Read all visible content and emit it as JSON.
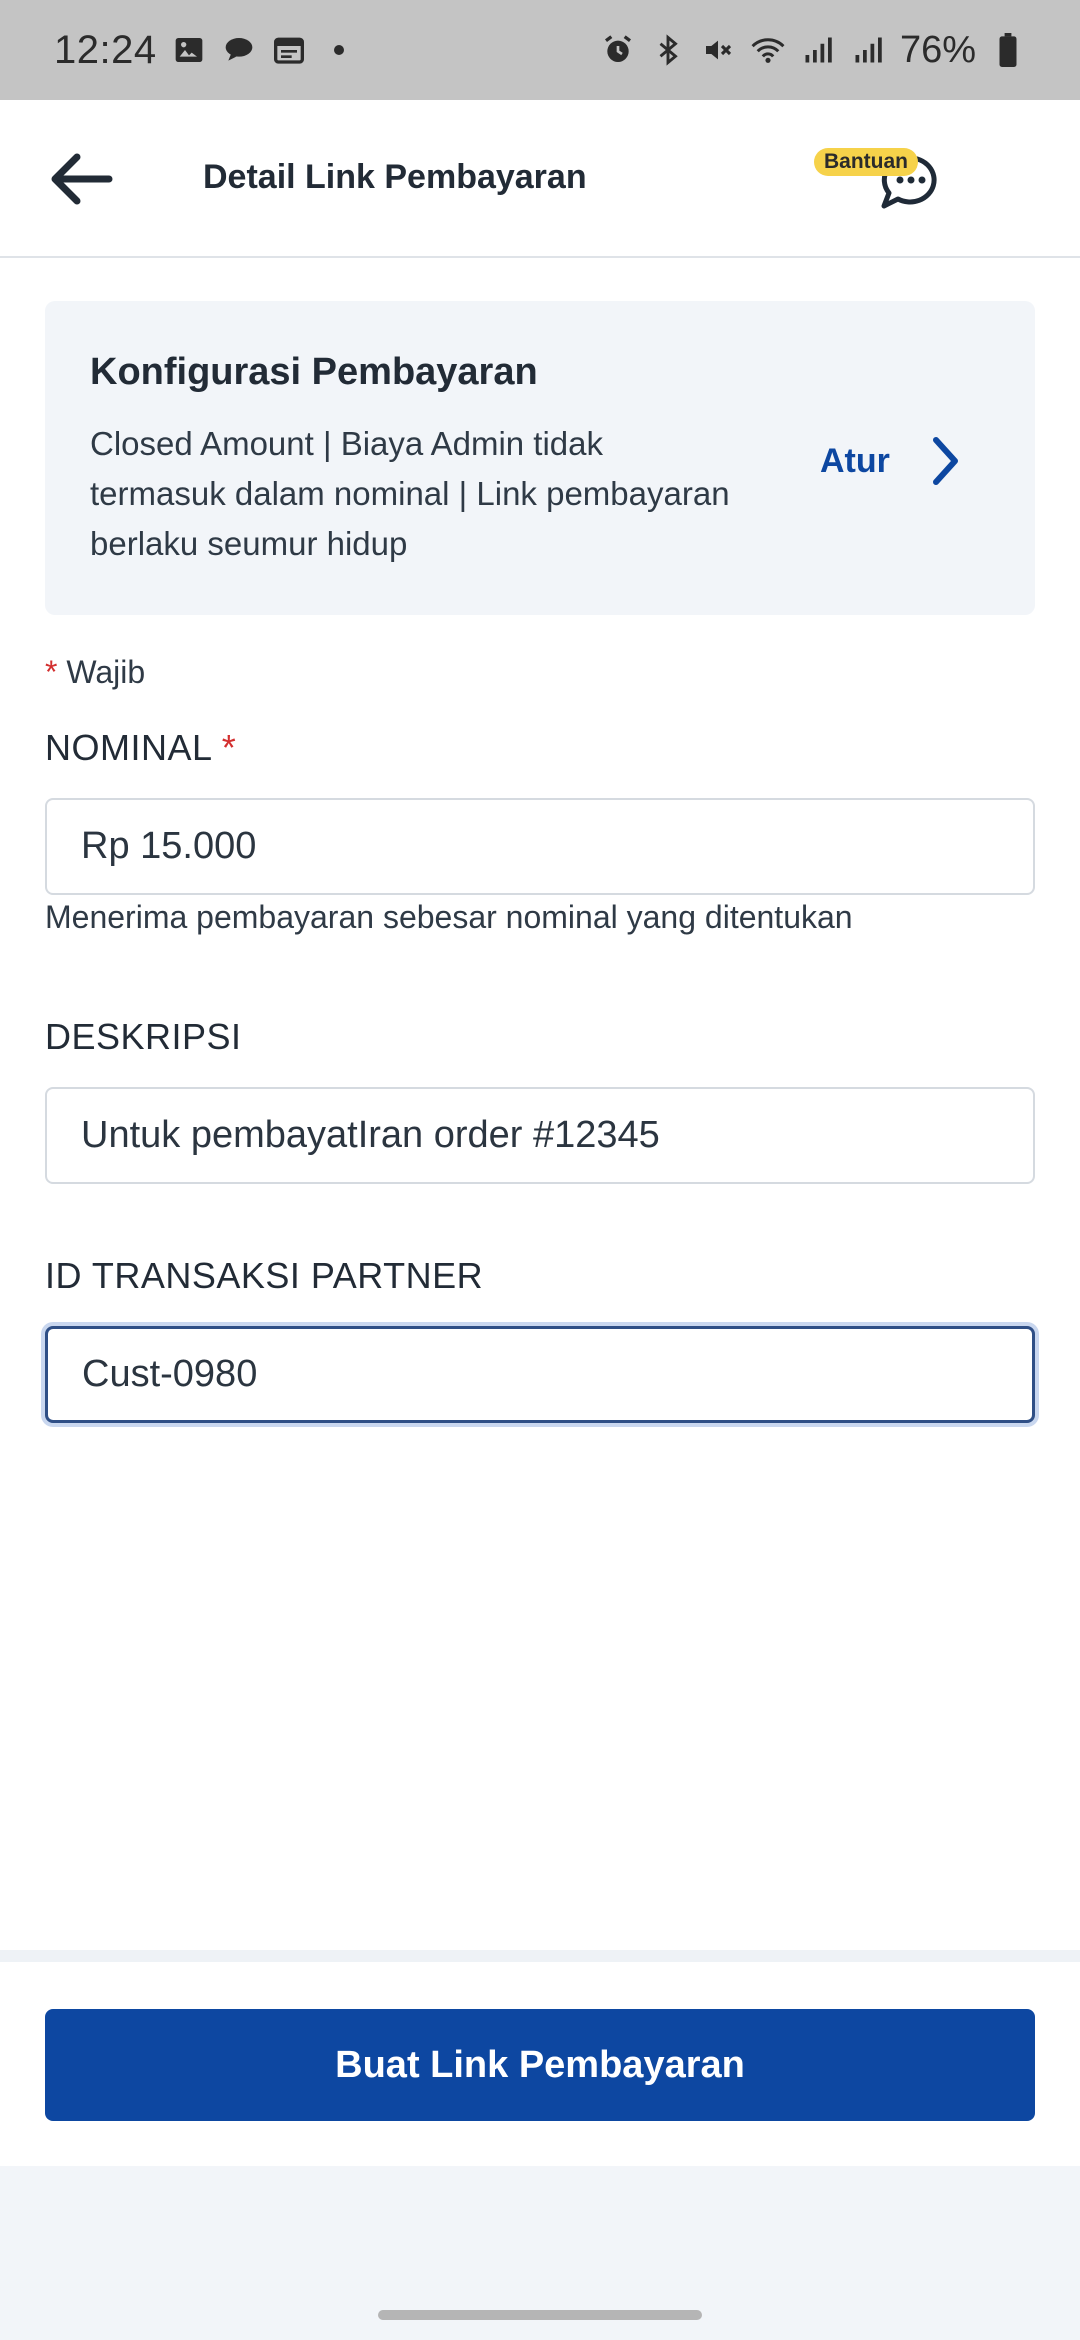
{
  "status_bar": {
    "time": "12:24",
    "battery": "76%",
    "icons": [
      "gallery-icon",
      "chat-icon",
      "calendar-icon",
      "dot-icon",
      "alarm-icon",
      "bluetooth-icon",
      "mute-icon",
      "wifi-icon",
      "signal-icon",
      "signal-icon",
      "battery-icon"
    ]
  },
  "appbar": {
    "title": "Detail Link Pembayaran",
    "help_badge": "Bantuan"
  },
  "config": {
    "title": "Konfigurasi Pembayaran",
    "description": "Closed Amount | Biaya Admin tidak termasuk dalam nominal | Link pembayaran berlaku seumur hidup",
    "action_label": "Atur"
  },
  "form": {
    "required_star": "*",
    "required_note": "Wajib",
    "nominal": {
      "label": "NOMINAL",
      "value": "Rp 15.000",
      "hint": "Menerima pembayaran sebesar nominal yang ditentukan"
    },
    "deskripsi": {
      "label": "DESKRIPSI",
      "value": "Untuk pembayatIran order #12345"
    },
    "id_transaksi": {
      "label": "ID TRANSAKSI PARTNER",
      "value": "Cust-0980"
    }
  },
  "cta": {
    "label": "Buat Link Pembayaran"
  },
  "colors": {
    "primary": "#0d47a1",
    "required": "#d32f2f",
    "badge": "#f6d24a",
    "card_bg": "#f2f5f9"
  }
}
